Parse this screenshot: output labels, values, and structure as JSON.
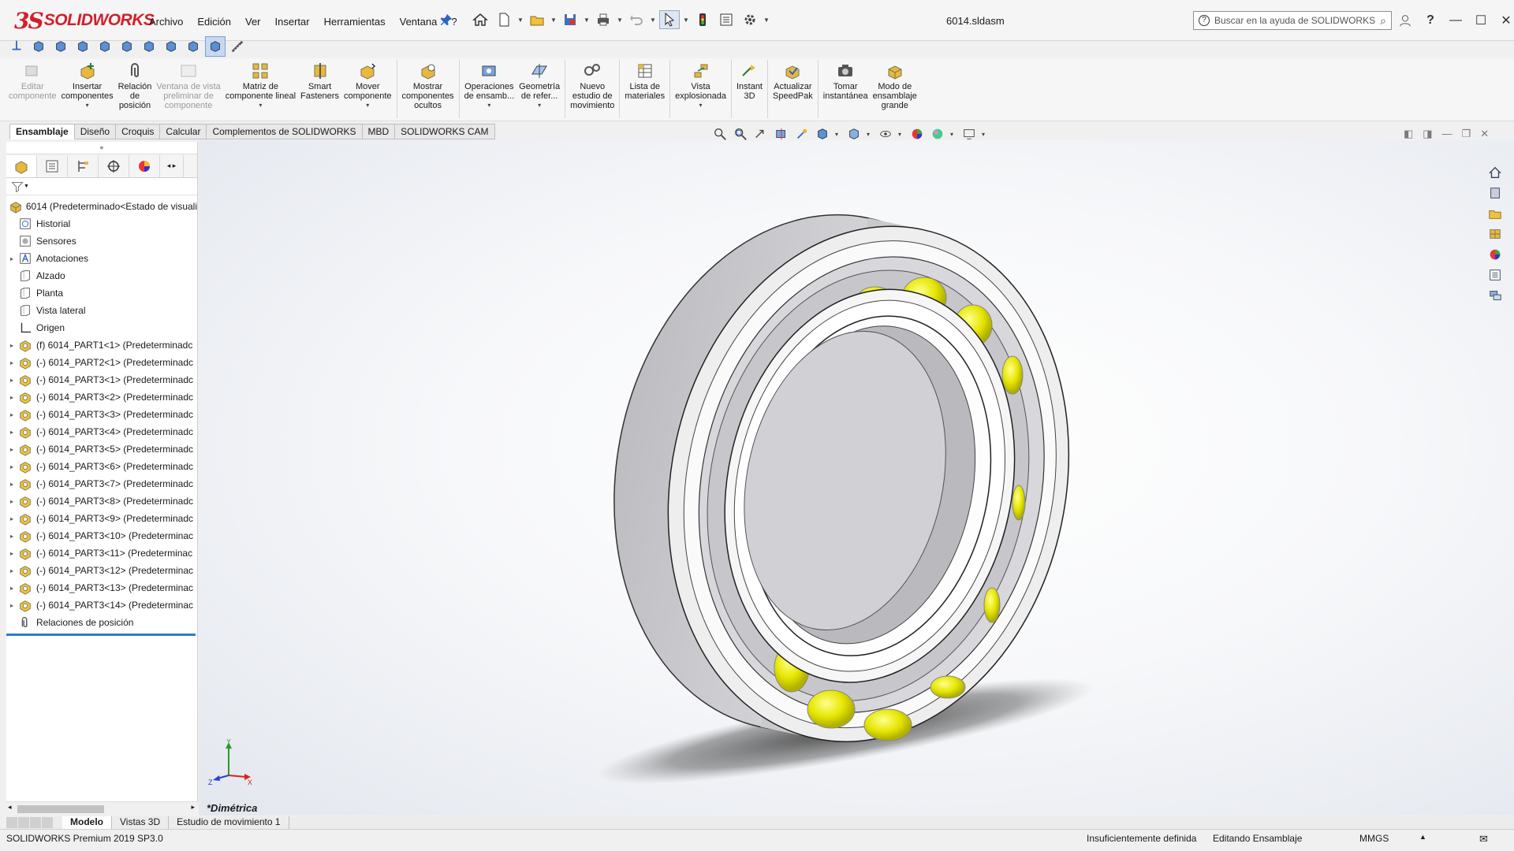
{
  "app": {
    "logo_ds": "3S",
    "logo_text": "SOLIDWORKS",
    "doc_title": "6014.sldasm",
    "help_placeholder": "Buscar en la ayuda de SOLIDWORKS"
  },
  "menus": [
    "Archivo",
    "Edición",
    "Ver",
    "Insertar",
    "Herramientas",
    "Ventana",
    "?"
  ],
  "command_manager": [
    {
      "line1": "Editar",
      "line2": "componente",
      "line3": "",
      "disabled": true
    },
    {
      "line1": "Insertar",
      "line2": "componentes",
      "line3": "",
      "disabled": false
    },
    {
      "line1": "Relación",
      "line2": "de",
      "line3": "posición",
      "disabled": false
    },
    {
      "line1": "Ventana de vista",
      "line2": "preliminar de",
      "line3": "componente",
      "disabled": true
    },
    {
      "line1": "Matriz de",
      "line2": "componente lineal",
      "line3": "",
      "disabled": false
    },
    {
      "line1": "Smart",
      "line2": "Fasteners",
      "line3": "",
      "disabled": false
    },
    {
      "line1": "Mover",
      "line2": "componente",
      "line3": "",
      "disabled": false
    },
    {
      "line1": "Mostrar",
      "line2": "componentes",
      "line3": "ocultos",
      "disabled": false
    },
    {
      "line1": "Operaciones",
      "line2": "de ensamb...",
      "line3": "",
      "disabled": false
    },
    {
      "line1": "Geometría",
      "line2": "de refer...",
      "line3": "",
      "disabled": false
    },
    {
      "line1": "Nuevo",
      "line2": "estudio de",
      "line3": "movimiento",
      "disabled": false
    },
    {
      "line1": "Lista de",
      "line2": "materiales",
      "line3": "",
      "disabled": false
    },
    {
      "line1": "Vista",
      "line2": "explosionada",
      "line3": "",
      "disabled": false
    },
    {
      "line1": "Instant",
      "line2": "3D",
      "line3": "",
      "disabled": false
    },
    {
      "line1": "Actualizar",
      "line2": "SpeedPak",
      "line3": "",
      "disabled": false
    },
    {
      "line1": "Tomar",
      "line2": "instantánea",
      "line3": "",
      "disabled": false
    },
    {
      "line1": "Modo de",
      "line2": "ensamblaje",
      "line3": "grande",
      "disabled": false
    }
  ],
  "tabs": [
    "Ensamblaje",
    "Diseño",
    "Croquis",
    "Calcular",
    "Complementos de SOLIDWORKS",
    "MBD",
    "SOLIDWORKS CAM"
  ],
  "tree": [
    {
      "label": "6014  (Predeterminado<Estado de visuali",
      "expander": "",
      "icon": "assembly"
    },
    {
      "label": "Historial",
      "expander": "",
      "icon": "history"
    },
    {
      "label": "Sensores",
      "expander": "",
      "icon": "sensor"
    },
    {
      "label": "Anotaciones",
      "expander": "▸",
      "icon": "annotation"
    },
    {
      "label": "Alzado",
      "expander": "",
      "icon": "plane"
    },
    {
      "label": "Planta",
      "expander": "",
      "icon": "plane"
    },
    {
      "label": "Vista lateral",
      "expander": "",
      "icon": "plane"
    },
    {
      "label": "Origen",
      "expander": "",
      "icon": "origin"
    },
    {
      "label": "(f) 6014_PART1<1> (Predeterminadc",
      "expander": "▸",
      "icon": "part"
    },
    {
      "label": "(-) 6014_PART2<1> (Predeterminadc",
      "expander": "▸",
      "icon": "part"
    },
    {
      "label": "(-) 6014_PART3<1> (Predeterminadc",
      "expander": "▸",
      "icon": "part"
    },
    {
      "label": "(-) 6014_PART3<2> (Predeterminadc",
      "expander": "▸",
      "icon": "part"
    },
    {
      "label": "(-) 6014_PART3<3> (Predeterminadc",
      "expander": "▸",
      "icon": "part"
    },
    {
      "label": "(-) 6014_PART3<4> (Predeterminadc",
      "expander": "▸",
      "icon": "part"
    },
    {
      "label": "(-) 6014_PART3<5> (Predeterminadc",
      "expander": "▸",
      "icon": "part"
    },
    {
      "label": "(-) 6014_PART3<6> (Predeterminadc",
      "expander": "▸",
      "icon": "part"
    },
    {
      "label": "(-) 6014_PART3<7> (Predeterminadc",
      "expander": "▸",
      "icon": "part"
    },
    {
      "label": "(-) 6014_PART3<8> (Predeterminadc",
      "expander": "▸",
      "icon": "part"
    },
    {
      "label": "(-) 6014_PART3<9> (Predeterminadc",
      "expander": "▸",
      "icon": "part"
    },
    {
      "label": "(-) 6014_PART3<10> (Predeterminac",
      "expander": "▸",
      "icon": "part"
    },
    {
      "label": "(-) 6014_PART3<11> (Predeterminac",
      "expander": "▸",
      "icon": "part"
    },
    {
      "label": "(-) 6014_PART3<12> (Predeterminac",
      "expander": "▸",
      "icon": "part"
    },
    {
      "label": "(-) 6014_PART3<13> (Predeterminac",
      "expander": "▸",
      "icon": "part"
    },
    {
      "label": "(-) 6014_PART3<14> (Predeterminac",
      "expander": "▸",
      "icon": "part"
    },
    {
      "label": "Relaciones de posición",
      "expander": "",
      "icon": "mates"
    }
  ],
  "graphics": {
    "view_label": "*Dimétrica",
    "triad_x": "X",
    "triad_y": "Y",
    "triad_z": "Z",
    "ring_color": "#c8c8cc",
    "ball_color": "#e8e800"
  },
  "bottom_tabs": [
    "Modelo",
    "Vistas 3D",
    "Estudio de movimiento 1"
  ],
  "status": {
    "product": "SOLIDWORKS Premium 2019 SP3.0",
    "definition": "Insuficientemente definida",
    "mode": "Editando Ensamblaje",
    "units": "MMGS"
  },
  "colors": {
    "brand": "#d0202a",
    "accent": "#2b7ad1"
  }
}
